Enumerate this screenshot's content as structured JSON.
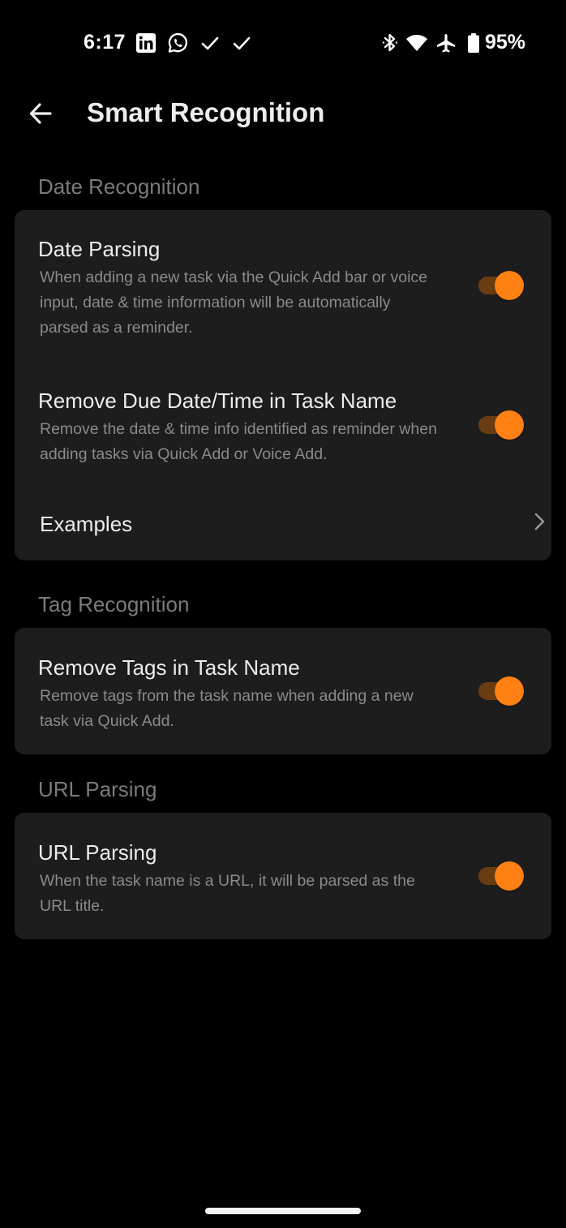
{
  "status_bar": {
    "time": "6:17",
    "battery_percent": "95%",
    "left_icons": [
      "linkedin-icon",
      "whatsapp-icon",
      "check-icon",
      "check-icon"
    ],
    "right_icons": [
      "bluetooth-icon",
      "wifi-icon",
      "airplane-icon",
      "battery-icon"
    ]
  },
  "app_bar": {
    "title": "Smart Recognition",
    "back_icon": "arrow-left-icon"
  },
  "sections": {
    "date": {
      "header": "Date Recognition",
      "date_parsing": {
        "title": "Date Parsing",
        "desc": "When adding a new task via the Quick Add bar or voice input, date & time information will be automatically parsed as a reminder.",
        "enabled": true
      },
      "remove_due": {
        "title": "Remove Due Date/Time in Task Name",
        "desc": "Remove the date & time info identified as reminder when adding tasks via Quick Add or Voice Add.",
        "enabled": true
      },
      "examples": {
        "title": "Examples"
      }
    },
    "tag": {
      "header": "Tag Recognition",
      "remove_tags": {
        "title": "Remove Tags in Task Name",
        "desc": "Remove tags from the task name when adding a new task via Quick Add.",
        "enabled": true
      }
    },
    "url": {
      "header": "URL Parsing",
      "url_parsing": {
        "title": "URL Parsing",
        "desc": "When the task name is a URL, it will be parsed as the URL title.",
        "enabled": true
      }
    }
  },
  "colors": {
    "accent": "#ff8013",
    "track_on": "#6a3c12",
    "card_bg": "#1d1d1d",
    "background": "#000000"
  }
}
